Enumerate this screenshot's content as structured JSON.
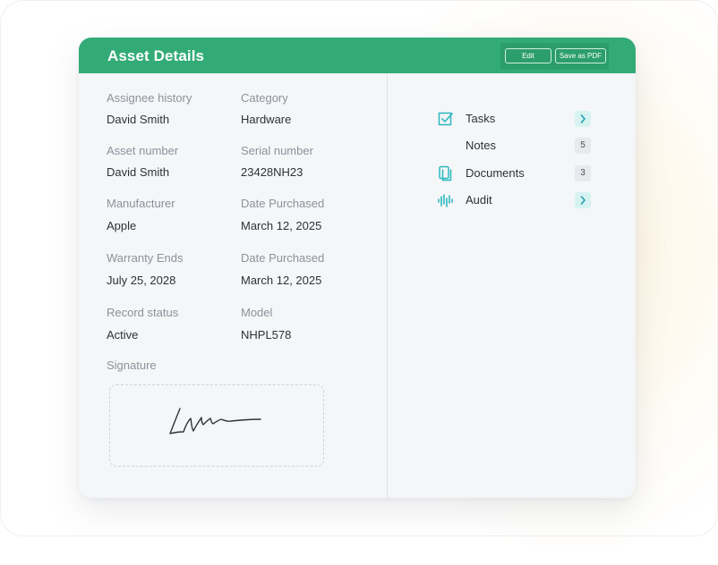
{
  "header": {
    "title": "Asset Details",
    "edit_label": "Edit",
    "save_pdf_label": "Save as PDF"
  },
  "fields": {
    "assignee_history": {
      "label": "Assignee history",
      "value": "David Smith"
    },
    "category": {
      "label": "Category",
      "value": "Hardware"
    },
    "asset_number": {
      "label": "Asset number",
      "value": "David Smith"
    },
    "serial_number": {
      "label": "Serial number",
      "value": "23428NH23"
    },
    "manufacturer": {
      "label": "Manufacturer",
      "value": "Apple"
    },
    "date_purchased_1": {
      "label": "Date Purchased",
      "value": "March 12, 2025"
    },
    "warranty_ends": {
      "label": "Warranty Ends",
      "value": "July 25, 2028"
    },
    "date_purchased_2": {
      "label": "Date Purchased",
      "value": "March 12, 2025"
    },
    "record_status": {
      "label": "Record status",
      "value": "Active"
    },
    "model": {
      "label": "Model",
      "value": "NHPL578"
    }
  },
  "signature": {
    "label": "Signature"
  },
  "sidebar": {
    "items": [
      {
        "label": "Tasks",
        "icon": "checkbox-icon",
        "action": "chevron"
      },
      {
        "label": "Notes",
        "count": "5"
      },
      {
        "label": "Documents",
        "icon": "documents-icon",
        "count": "3"
      },
      {
        "label": "Audit",
        "icon": "audit-wave-icon",
        "action": "chevron"
      }
    ]
  },
  "colors": {
    "header": "#33ab77",
    "icon_teal": "#2bb8bf",
    "card_bg": "#f4f6f8"
  }
}
